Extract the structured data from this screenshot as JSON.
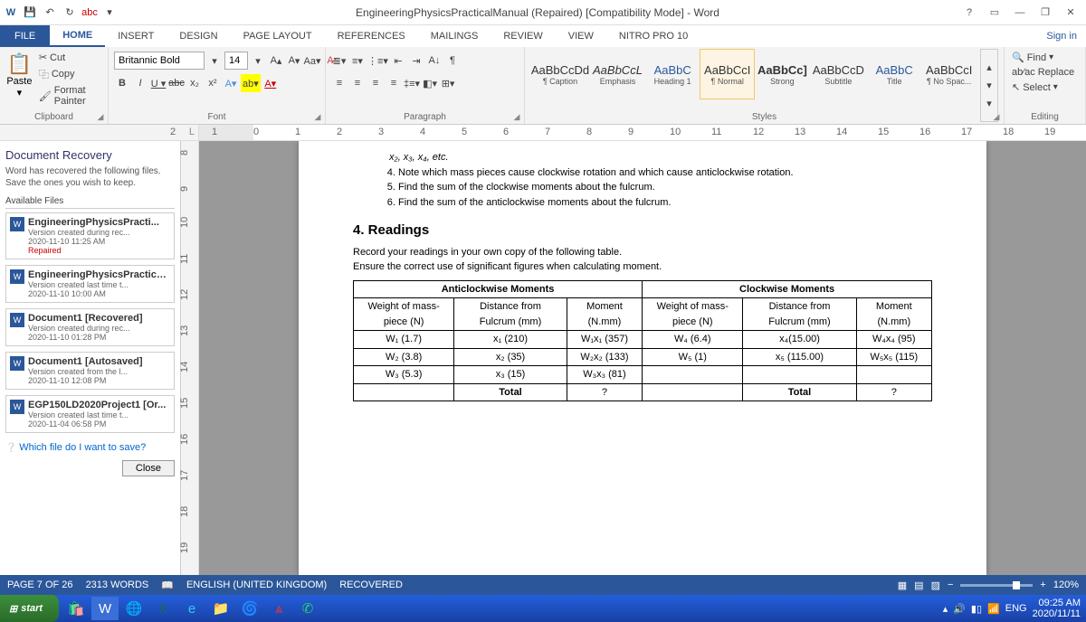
{
  "title": "EngineeringPhysicsPracticalManual (Repaired) [Compatibility Mode] - Word",
  "qat": {
    "save": "💾",
    "undo": "↶",
    "redo": "↻",
    "spell": "abc"
  },
  "winctrl": {
    "help": "?",
    "ropt": "▭",
    "min": "—",
    "restore": "❐",
    "close": "✕"
  },
  "tabs": [
    "FILE",
    "HOME",
    "INSERT",
    "DESIGN",
    "PAGE LAYOUT",
    "REFERENCES",
    "MAILINGS",
    "REVIEW",
    "VIEW",
    "NITRO PRO 10"
  ],
  "signin": "Sign in",
  "clipboard": {
    "paste": "Paste",
    "cut": "Cut",
    "copy": "Copy",
    "fmt": "Format Painter",
    "label": "Clipboard"
  },
  "font": {
    "name": "Britannic Bold",
    "size": "14",
    "label": "Font"
  },
  "para": {
    "label": "Paragraph"
  },
  "styles": {
    "label": "Styles",
    "items": [
      {
        "prev": "AaBbCcDd",
        "name": "¶ Caption"
      },
      {
        "prev": "AaBbCcL",
        "name": "Emphasis",
        "i": true
      },
      {
        "prev": "AaBbC",
        "name": "Heading 1",
        "big": true
      },
      {
        "prev": "AaBbCcI",
        "name": "¶ Normal",
        "sel": true
      },
      {
        "prev": "AaBbCc]",
        "name": "Strong",
        "b": true
      },
      {
        "prev": "AaBbCcD",
        "name": "Subtitle"
      },
      {
        "prev": "AaBbC",
        "name": "Title",
        "big": true
      },
      {
        "prev": "AaBbCcI",
        "name": "¶ No Spac..."
      }
    ]
  },
  "editing": {
    "find": "Find",
    "replace": "Replace",
    "select": "Select",
    "label": "Editing"
  },
  "recovery": {
    "title": "Document Recovery",
    "desc": "Word has recovered the following files. Save the ones you wish to keep.",
    "avail": "Available Files",
    "items": [
      {
        "fn": "EngineeringPhysicsPracti...",
        "sub": "Version created during rec...",
        "dt": "2020-11-10 11:25 AM",
        "rep": "Repaired"
      },
      {
        "fn": "EngineeringPhysicsPractica...",
        "sub": "Version created last time t...",
        "dt": "2020-11-10 10:00 AM"
      },
      {
        "fn": "Document1 [Recovered]",
        "sub": "Version created during rec...",
        "dt": "2020-11-10 01:28 PM"
      },
      {
        "fn": "Document1 [Autosaved]",
        "sub": "Version created from the l...",
        "dt": "2020-11-10 12:08 PM"
      },
      {
        "fn": "EGP150LD2020Project1 [Or...",
        "sub": "Version created last time t...",
        "dt": "2020-11-04 06:58 PM"
      }
    ],
    "which": "Which file do I want to save?",
    "close": "Close"
  },
  "doc": {
    "subline": "x₂, x₃, x₄, etc.",
    "li4": "Note which mass pieces cause clockwise rotation and which cause anticlockwise rotation.",
    "li5": "Find the sum of the clockwise moments about the fulcrum.",
    "li6": "Find the sum of the anticlockwise moments about the fulcrum.",
    "h_readings": "4. Readings",
    "p_rec": "Record your readings in your own copy of the following table.",
    "p_sig": "Ensure the correct use of significant figures when calculating moment.",
    "tbl": {
      "h_acw": "Anticlockwise Moments",
      "h_cw": "Clockwise Moments",
      "h_w": "Weight of mass-piece (N)",
      "h_d": "Distance from Fulcrum (mm)",
      "h_m": "Moment (N.mm)",
      "acw": [
        {
          "w": "W₁ (1.7)",
          "d": "x₁ (210)",
          "m": "W₁x₁ (357)"
        },
        {
          "w": "W₂ (3.8)",
          "d": "x₂ (35)",
          "m": "W₂x₂ (133)"
        },
        {
          "w": "W₃ (5.3)",
          "d": "x₃ (15)",
          "m": "W₃x₃ (81)"
        },
        {
          "w": "",
          "d": "Total",
          "m": "?"
        }
      ],
      "cw": [
        {
          "w": "W₄ (6.4)",
          "d": "x₄(15.00)",
          "m": "W₄x₄ (95)"
        },
        {
          "w": "W₅ (1)",
          "d": "x₅ (115.00)",
          "m": "W₅x₅ (115)"
        },
        {
          "w": "",
          "d": "",
          "m": ""
        },
        {
          "w": "",
          "d": "Total",
          "m": "?"
        }
      ]
    }
  },
  "status": {
    "page": "PAGE 7 OF 26",
    "words": "2313 WORDS",
    "lang": "ENGLISH (UNITED KINGDOM)",
    "rec": "RECOVERED",
    "zoom": "120%"
  },
  "taskbar": {
    "start": "start",
    "lang": "ENG",
    "time": "09:25 AM",
    "date": "2020/11/11"
  }
}
